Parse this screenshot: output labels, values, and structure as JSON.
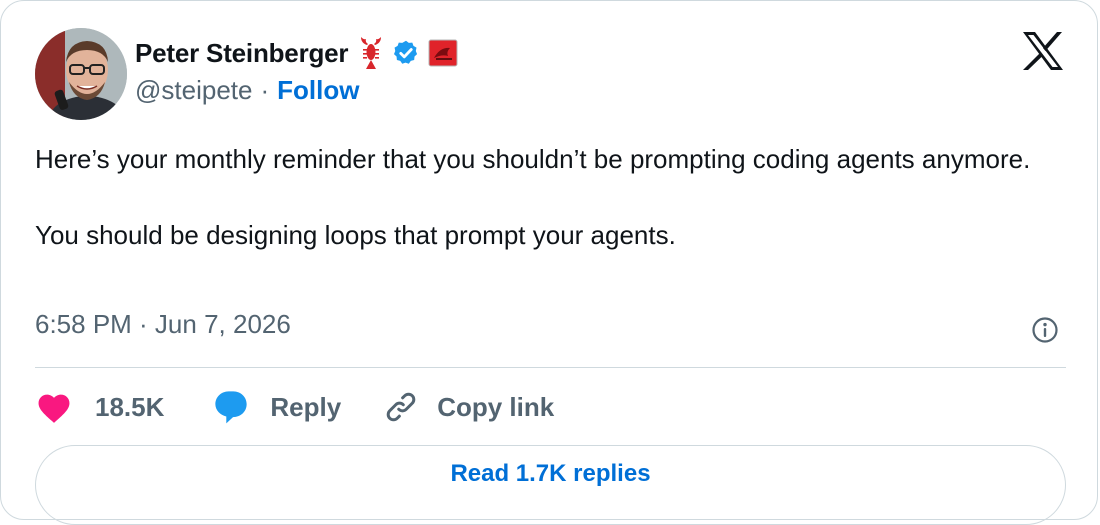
{
  "author": {
    "display_name": "Peter Steinberger",
    "handle": "@steipete",
    "separator": "·",
    "follow_label": "Follow",
    "avatar_icon": "person-avatar",
    "name_emoji_icon": "lobster-icon",
    "verified_icon": "verified-badge-icon",
    "affiliate_icon": "red-badge-icon",
    "verified_color": "#1d9bf0"
  },
  "platform": {
    "logo_icon": "x-logo-icon"
  },
  "tweet": {
    "paragraphs": [
      "Here’s your monthly reminder that you shouldn’t be prompting coding agents anymore.",
      "You should be designing loops that prompt your agents."
    ],
    "timestamp": "6:58 PM · Jun 7, 2026"
  },
  "actions": {
    "like_count": "18.5K",
    "reply_label": "Reply",
    "copy_link_label": "Copy link",
    "like_color": "#f91880",
    "reply_color": "#1d9bf0"
  },
  "footer": {
    "read_replies_label": "Read 1.7K replies"
  },
  "colors": {
    "link": "#006fd6",
    "secondary_text": "#536471",
    "border": "#cfd9de"
  }
}
